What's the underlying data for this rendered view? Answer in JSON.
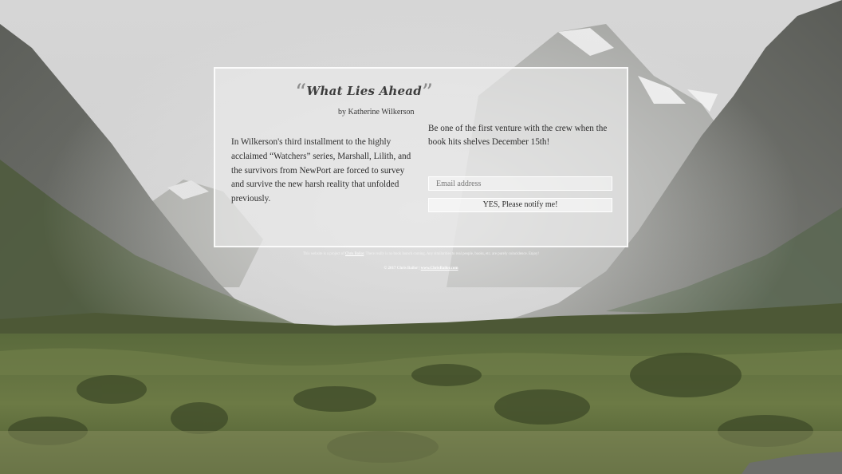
{
  "book": {
    "title": "What Lies Ahead",
    "open_quote": "“",
    "close_quote": "”",
    "byline": "by Katherine Wilkerson",
    "blurb": "In Wilkerson's third installment to the highly acclaimed “Watchers” series, Marshall, Lilith, and the survivors from NewPort are forced to survey and survive the new harsh reality that unfolded previously."
  },
  "signup": {
    "cta_text": "Be one of the first venture with the crew when the book hits shelves December 15th!",
    "email_placeholder": "Email address",
    "button_label": "YES, Please notify me!"
  },
  "footer": {
    "note_prefix": "This website is a project of ",
    "note_link": "Chris Bailor",
    "note_suffix": ". There really is no book launch coming. Any similarities to real people, books, etc. are purely coincidence. Enjoy!",
    "copyright_prefix": "© 2017 Chris Bailor | ",
    "copyright_link": "www.ChrisBailor.com"
  },
  "colors": {
    "card_border": "#ffffff",
    "text_dark": "#2e2e2e",
    "quote_gray": "#8c8c8c",
    "grass_green": "#4f5e35"
  }
}
